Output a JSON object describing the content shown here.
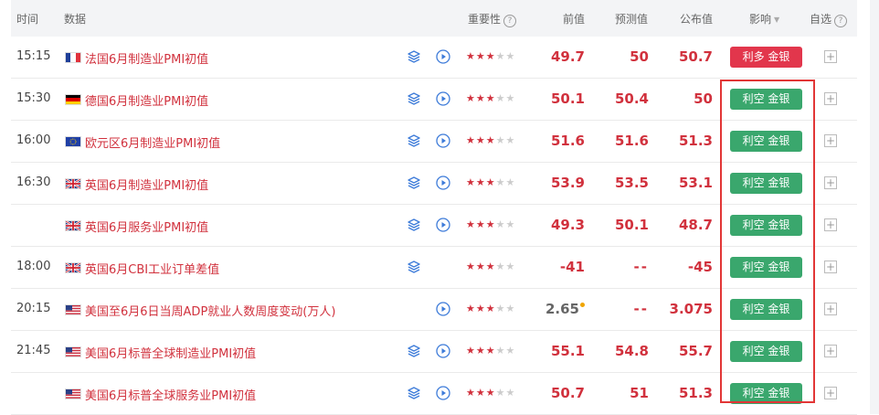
{
  "header": {
    "time": "时间",
    "data": "数据",
    "importance": "重要性",
    "importance_help": "?",
    "previous": "前值",
    "forecast": "预测值",
    "actual": "公布值",
    "impact": "影响",
    "impact_caret": "▼",
    "watch": "自选",
    "watch_help": "?"
  },
  "rows": [
    {
      "time": "15:15",
      "flag": "france-flag",
      "name": "法国6月制造业PMI初值",
      "layer": true,
      "play": true,
      "stars": 3,
      "previous": "49.7",
      "forecast": "50",
      "actual": "50.7",
      "impact": "利多 金银",
      "impact_type": "bullish",
      "add": "+"
    },
    {
      "time": "15:30",
      "flag": "germany-flag",
      "name": "德国6月制造业PMI初值",
      "layer": true,
      "play": true,
      "stars": 3,
      "previous": "50.1",
      "forecast": "50.4",
      "actual": "50",
      "impact": "利空 金银",
      "impact_type": "bearish",
      "add": "+"
    },
    {
      "time": "16:00",
      "flag": "eu-flag",
      "name": "欧元区6月制造业PMI初值",
      "layer": true,
      "play": true,
      "stars": 3,
      "previous": "51.6",
      "forecast": "51.6",
      "actual": "51.3",
      "impact": "利空 金银",
      "impact_type": "bearish",
      "add": "+"
    },
    {
      "time": "16:30",
      "flag": "uk-flag",
      "name": "英国6月制造业PMI初值",
      "layer": true,
      "play": true,
      "stars": 3,
      "previous": "53.9",
      "forecast": "53.5",
      "actual": "53.1",
      "impact": "利空 金银",
      "impact_type": "bearish",
      "add": "+"
    },
    {
      "time": "",
      "flag": "uk-flag",
      "name": "英国6月服务业PMI初值",
      "layer": true,
      "play": true,
      "stars": 3,
      "previous": "49.3",
      "forecast": "50.1",
      "actual": "48.7",
      "impact": "利空 金银",
      "impact_type": "bearish",
      "add": "+"
    },
    {
      "time": "18:00",
      "flag": "uk-flag",
      "name": "英国6月CBI工业订单差值",
      "layer": true,
      "play": false,
      "stars": 3,
      "previous": "-41",
      "forecast": "--",
      "actual": "-45",
      "impact": "利空 金银",
      "impact_type": "bearish",
      "add": "+"
    },
    {
      "time": "20:15",
      "flag": "us-flag",
      "name": "美国至6月6日当周ADP就业人数周度变动(万人)",
      "layer": false,
      "play": true,
      "stars": 3,
      "previous": "2.65",
      "previous_revised": true,
      "forecast": "--",
      "actual": "3.075",
      "impact": "利空 金银",
      "impact_type": "bearish",
      "add": "+"
    },
    {
      "time": "21:45",
      "flag": "us-flag",
      "name": "美国6月标普全球制造业PMI初值",
      "layer": true,
      "play": true,
      "stars": 3,
      "previous": "55.1",
      "forecast": "54.8",
      "actual": "55.7",
      "impact": "利空 金银",
      "impact_type": "bearish",
      "add": "+"
    },
    {
      "time": "",
      "flag": "us-flag",
      "name": "美国6月标普全球服务业PMI初值",
      "layer": true,
      "play": true,
      "stars": 3,
      "previous": "50.7",
      "forecast": "51",
      "actual": "51.3",
      "impact": "利空 金银",
      "impact_type": "bearish",
      "add": "+"
    }
  ],
  "colors": {
    "bullish": "#e2364c",
    "bearish": "#3aa76d",
    "text_red": "#d1313d",
    "highlight": "#e23636"
  }
}
